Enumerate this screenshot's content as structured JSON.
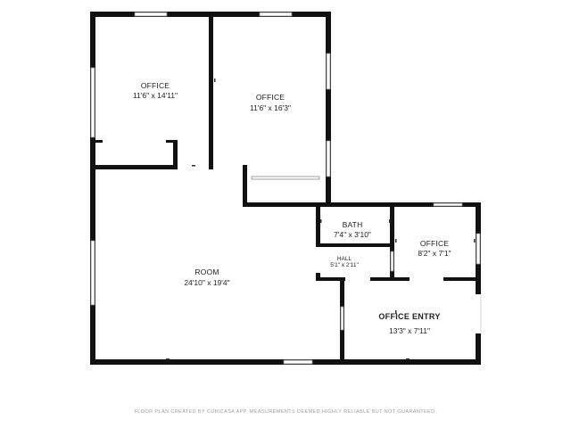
{
  "rooms": [
    {
      "id": "office-1",
      "name": "OFFICE",
      "dim": "11'6\" x 14'11\""
    },
    {
      "id": "office-2",
      "name": "OFFICE",
      "dim": "11'6\" x 16'3\""
    },
    {
      "id": "bath",
      "name": "BATH",
      "dim": "7'4\" x 3'10\""
    },
    {
      "id": "office-3",
      "name": "OFFICE",
      "dim": "8'2\" x 7'1\""
    },
    {
      "id": "hall",
      "name": "HALL",
      "dim": "5'1\" x 2'11\""
    },
    {
      "id": "room",
      "name": "ROOM",
      "dim": "24'10\" x 19'4\""
    },
    {
      "id": "office-entry",
      "name": "OFFICE ENTRY",
      "dim": "13'3\" x 7'11\""
    }
  ],
  "footer": "FLOOR PLAN CREATED BY CUBICASA APP. MEASUREMENTS DEEMED HIGHLY RELIABLE BUT NOT GUARANTEED."
}
